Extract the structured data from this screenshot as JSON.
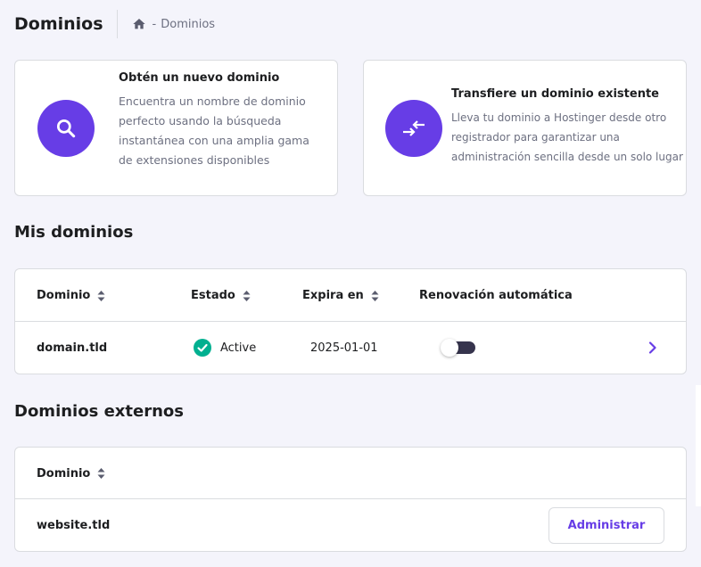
{
  "header": {
    "title": "Dominios",
    "breadcrumb": {
      "separator": "-",
      "current": "Dominios"
    }
  },
  "promo_new": {
    "title": "Obtén un nuevo dominio",
    "lines": [
      "Encuentra un nombre de dominio",
      "perfecto usando la búsqueda",
      "instantánea con una amplia gama",
      "de extensiones disponibles"
    ],
    "icon": "search-icon"
  },
  "promo_transfer": {
    "title": "Transfiere un dominio existente",
    "lines": [
      "Lleva tu dominio a Hostinger desde otro",
      "registrador para garantizar una",
      "administración sencilla desde un solo lugar"
    ],
    "icon": "transfer-arrows-icon"
  },
  "my_domains": {
    "title": "Mis dominios",
    "columns": [
      "Dominio",
      "Estado",
      "Expira en",
      "Renovación automática"
    ],
    "rows": [
      {
        "domain": "domain.tld",
        "status": "Active",
        "expires": "2025-01-01",
        "auto_renew": false
      }
    ]
  },
  "external_domains": {
    "title": "Dominios externos",
    "columns": [
      "Dominio"
    ],
    "rows": [
      {
        "domain": "website.tld",
        "action": "Administrar"
      }
    ]
  },
  "colors": {
    "accent": "#673de6",
    "success": "#00b090",
    "text": "#1d1e20",
    "muted": "#6d7081",
    "background": "#f4f4fb"
  }
}
